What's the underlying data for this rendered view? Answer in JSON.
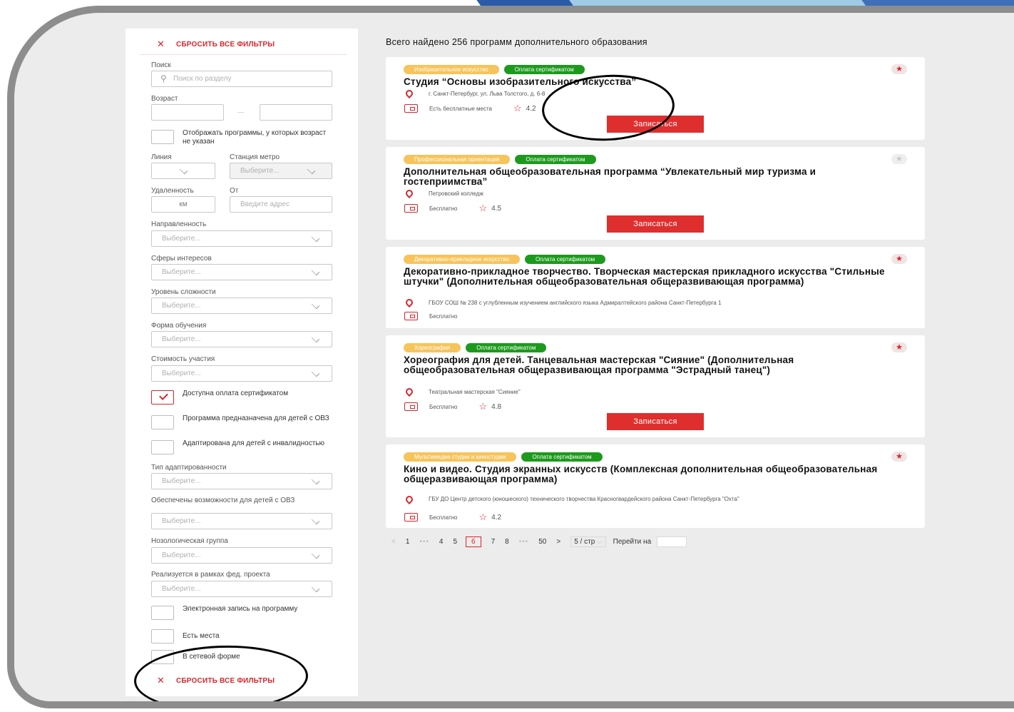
{
  "filters": {
    "reset_label": "СБРОСИТЬ ВСЕ ФИЛЬТРЫ",
    "search_label": "Поиск",
    "search_placeholder": "Поиск по разделу",
    "age_label": "Возраст",
    "age_dash": "—",
    "age_unspecified_label": "Отображать программы, у которых возраст не указан",
    "line_label": "Линия",
    "metro_label": "Станция метро",
    "metro_placeholder": "Выберите...",
    "distance_label": "Удаленность",
    "distance_unit": "км",
    "from_label": "От",
    "address_placeholder": "Введите адрес",
    "select_placeholder": "Выберите...",
    "direction_label": "Направленность",
    "interests_label": "Сферы интересов",
    "difficulty_label": "Уровень сложности",
    "study_form_label": "Форма обучения",
    "cost_label": "Стоимость участия",
    "cert_pay_label": "Доступна оплата сертификатом",
    "ovz_label": "Программа предназначена для детей с ОВЗ",
    "disabled_label": "Адаптирована для детей с инвалидностью",
    "adaptation_type_label": "Тип адаптированности",
    "ovz_opportunities_label": "Обеспечены возможности для детей с ОВЗ",
    "nosology_label": "Нозологическая группа",
    "federal_project_label": "Реализуется в рамках фед. проекта",
    "e_enroll_label": "Электронная запись на программу",
    "has_places_label": "Есть места",
    "network_label": "В сетевой форме"
  },
  "results": {
    "total_label": "Всего найдено 256 программ дополнительного образования",
    "enroll_label": "Записаться",
    "cert_badge": "Оплата сертификатом",
    "cards": [
      {
        "category": "Изобразительное искусство",
        "title": "Студия “Основы изобразительного искусства”",
        "address": "г. Санкт-Петербург, ул. Льва Толстого, д. 6-8",
        "price": "Есть бесплатные места",
        "rating": "4.2"
      },
      {
        "category": "Профессиональная ориентация",
        "title": "Дополнительная общеобразовательная программа “Увлекательный мир туризма и гостеприимства”",
        "address": "Петровский колледж",
        "price": "Бесплатно",
        "rating": "4.5"
      },
      {
        "category": "Декоративно-прикладное искусство",
        "title": "Декоративно-прикладное творчество. Творческая мастерская прикладного искусства \"Стильные штучки\" (Дополнительная общеобразовательная общеразвивающая программа)",
        "address": "ГБОУ СОШ № 238 с углубленным изучением английского языка Адмиралтейского района Санкт-Петербурга 1",
        "price": "Бесплатно"
      },
      {
        "category": "Хореография",
        "title": "Хореография для детей. Танцевальная мастерская \"Сияние\" (Дополнительная общеобразовательная общеразвивающая программа \"Эстрадный танец\")",
        "address": "Театральная мастерская \"Сияние\"",
        "price": "Бесплатно",
        "rating": "4.8"
      },
      {
        "category": "Мультимедиа студии и киностудии",
        "title": "Кино и видео. Студия экранных искусств (Комплексная дополнительная общеобразовательная общеразвивающая программа)",
        "address": "ГБУ ДО Центр детского (юношеского) технического творчества Красногвардейского района Санкт-Петербурга \"Охта\"",
        "price": "Бесплатно",
        "rating": "4.2"
      }
    ]
  },
  "pagination": {
    "prev": "<",
    "p1": "1",
    "dots": "•••",
    "p4": "4",
    "p5": "5",
    "current": "6",
    "p7": "7",
    "p8": "8",
    "p50": "50",
    "next": ">",
    "page_size": "5 / стр",
    "goto_label": "Перейти на"
  },
  "colors": {
    "accent": "#d9252c",
    "badge_green": "#1d9a1d",
    "badge_yellow": "#f6c45b",
    "background": "#ececec"
  }
}
